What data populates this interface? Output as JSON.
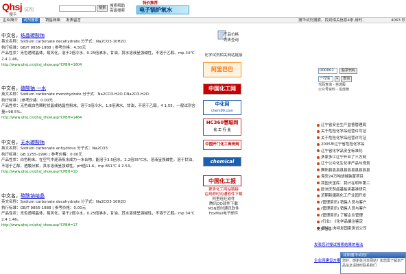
{
  "header": {
    "logo_text": "Qhsj",
    "logo_sub": "搜卡",
    "tagline": "试剂",
    "search_button": "搜索",
    "search_help": [
      "搜索帮助",
      "高级搜索"
    ],
    "promo_title": "特价推荐",
    "promo_banner": "电子锅炉氧水"
  },
  "nav": {
    "items": [
      "企业简介",
      "试剂搜索",
      "销售网络",
      "发表留言"
    ],
    "active_index": 1,
    "status_text": "搜华试剂搜索，找到相关信息4条,用时：",
    "status_time": "4063 秒"
  },
  "entries": [
    {
      "title_prefix": "中文名，",
      "name": "结晶碳酸钠",
      "english": "英文名称：Sodium carbonate decahydrate  分子式：Na2CO3·10H2O",
      "standard": "执行标准：GB/T 9856-1988 | 参考价格：4.50元",
      "description": "产品性状：无色透明晶体。易风化，溶于2倍冷水，0.25倍沸水，甘油，其水溶液呈强碱性，不溶于乙醇。mp 34℃ 2.4 1.46。",
      "url": "http://www.qhsj.cn/qhsj_show.asp?CPBH=1604"
    },
    {
      "title_prefix": "中文名，",
      "name": "碳酸钠  一水",
      "english": "英文名称：Sodium carbonate monohydrate  分子式：Na2CO3·H2O CNa2O3·H2O",
      "standard": "执行标准：[参考价格：0.00元",
      "description": "产品性状：无色或白色颗粒状晶或结晶性粉末，溶于3倍冷水，1.8倍沸水，甘油，不溶于乙醇，4 1.55，一般试剂含量>98.5%。",
      "url": "http://www.qhsj.cn/qhsj_show.asp?CPBH=1464"
    },
    {
      "title_prefix": "中文名，",
      "name": "无水碳酸钠",
      "english": "英文名称：Sodium carbonate anhydrous  分子式：Na2CO3",
      "standard": "执行标准：GB 1255-1990 | 参考价格：0.00元",
      "description": "产品性状：白色粉末。在空气中逐渐吸水成为一水合物，能溶于3.5倍水，2.2倍35℃水，溶液呈强碱性。溶于甘油，不溶于乙醇，透酸分解，其水溶液呈强碱性，pH值11.6，mp 851℃ 4 2.53。",
      "url": "http://www.qhsj.cn/qhsj_show.asp?CPBH=10"
    },
    {
      "title_prefix": "中文名，",
      "name": "碳酸钠结晶",
      "english": "英文名称：Sodium carbonate decahydrate  分子式：Na2CO3·10H2O",
      "standard": "执行标准：GB/T 9856-1988 | 参考价格：0.00元",
      "description": "产品性状：无色透明晶体，易风化，溶于2倍冷水，0.25倍沸水，甘油，其水溶液呈强碱性，不溶于乙醇。mp 34℃ 2.4 1.46。",
      "url": "http://www.qhsj.cn/qhsj_show.asp?CPBH=17"
    }
  ],
  "mid": {
    "icon_label_1": "产品价格",
    "icon_label_2": "列表查询",
    "links_title": "化学试剂相关网站链接",
    "ads": [
      "阿里巴巴",
      "中国化工网",
      "中化网",
      "HC360慧聪网",
      "中国开门化工商务网",
      "chemical",
      "中国化工报"
    ],
    "ad_captions": [
      "",
      "",
      "chem99.com",
      "化 工 行 业",
      "",
      "",
      ""
    ],
    "footer_lines": [
      "更多化工网站链接",
      "在线即时沟通软件下载",
      "阿里旺旺软件",
      "腾讯QQ软件下载",
      "MSN即时通讯软件",
      "FoxMail电子邮件"
    ]
  },
  "right": {
    "stock_value": "000001",
    "stock_button": "股票代码",
    "select_value": "一行情",
    "query_button": "查询",
    "stock_links": [
      "代码查询 - 自选股",
      "公众号资料 - 龙虎榜"
    ],
    "news": [
      "辽宁省安全生产监督管理局",
      "关于危险化学品经营许可证",
      "关于危险化学品经营许可证",
      "2005年辽宁省危险化学品",
      "辽宁省化学品安全标准化",
      "多家多江辽宁开业了三方网",
      "辽宁公众化生化学产品与规划",
      "舞阳县县县县县县县县县县县",
      "海安24万吨烧碱装置项目",
      "我国天宝库：我计在明年第二",
      "欧洲天然卤基盐类基准研究",
      "近期新疆新化工产业园开发",
      "(管理资讯) 销售人员与客户",
      "(管理资讯) 销售人员与客户",
      "(管理资讯) 了解企业管理",
      "(行业) 《化学品编注鉴定",
      "(职业) 肉特发国家测试公司"
    ],
    "more": "更多信息"
  },
  "bottom": {
    "link_1": "发表您对搜试搜索结果的看法",
    "link_2": "企业网建设方案"
  },
  "popup": {
    "title": "沈阳搜华试剂厂",
    "body": "您好，感谢关注本网站！如您需了解本产品信息请随时联系我们"
  }
}
